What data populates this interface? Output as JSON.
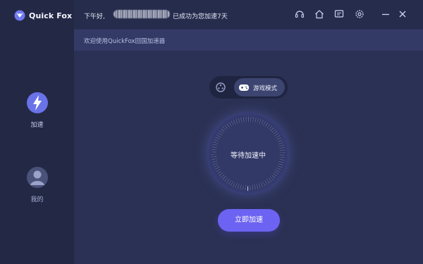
{
  "app": {
    "name": "Quick Fox"
  },
  "sidebar": {
    "items": [
      {
        "label": "加速",
        "icon": "lightning-icon"
      },
      {
        "label": "我的",
        "icon": "user-avatar-icon"
      }
    ]
  },
  "topbar": {
    "greeting": "下午好,",
    "status": "已成功为您加速7天",
    "icons": [
      "headset-icon",
      "home-icon",
      "message-icon",
      "settings-icon",
      "minimize-icon",
      "close-icon"
    ]
  },
  "subbar": {
    "welcome": "欢迎使用QuickFox回国加速器"
  },
  "mode_toggle": {
    "options": [
      {
        "label": "",
        "icon": "video-reel-icon",
        "active": false
      },
      {
        "label": "游戏模式",
        "icon": "gamepad-icon",
        "active": true
      }
    ]
  },
  "dial": {
    "status": "等待加速中"
  },
  "start_button": {
    "label": "立即加速"
  },
  "colors": {
    "accent": "#6d63f2",
    "sidebar_bg": "#232845",
    "main_bg": "#2b3154"
  }
}
